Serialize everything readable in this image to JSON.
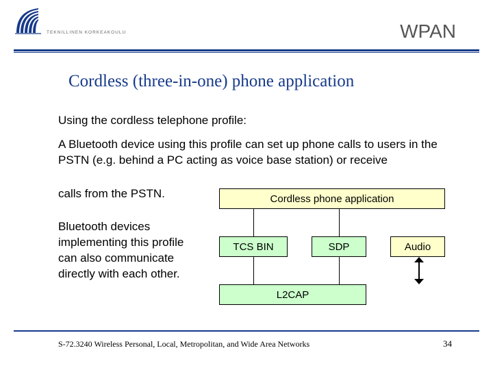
{
  "header": {
    "university": "TEKNILLINEN KORKEAKOULU",
    "topic": "WPAN"
  },
  "title": "Cordless (three-in-one) phone application",
  "para1": "Using the cordless telephone profile:",
  "para2": "A Bluetooth device using this profile can set up phone calls to users in the PSTN (e.g. behind a PC acting as voice base station) or receive",
  "para2b": "calls from the PSTN.",
  "para3": "Bluetooth devices implementing this profile can also communicate directly with each other.",
  "diagram": {
    "app": "Cordless phone application",
    "tcs": "TCS BIN",
    "sdp": "SDP",
    "audio": "Audio",
    "l2cap": "L2CAP"
  },
  "footer": {
    "left": "S-72.3240 Wireless Personal, Local, Metropolitan, and Wide Area Networks",
    "page": "34"
  }
}
